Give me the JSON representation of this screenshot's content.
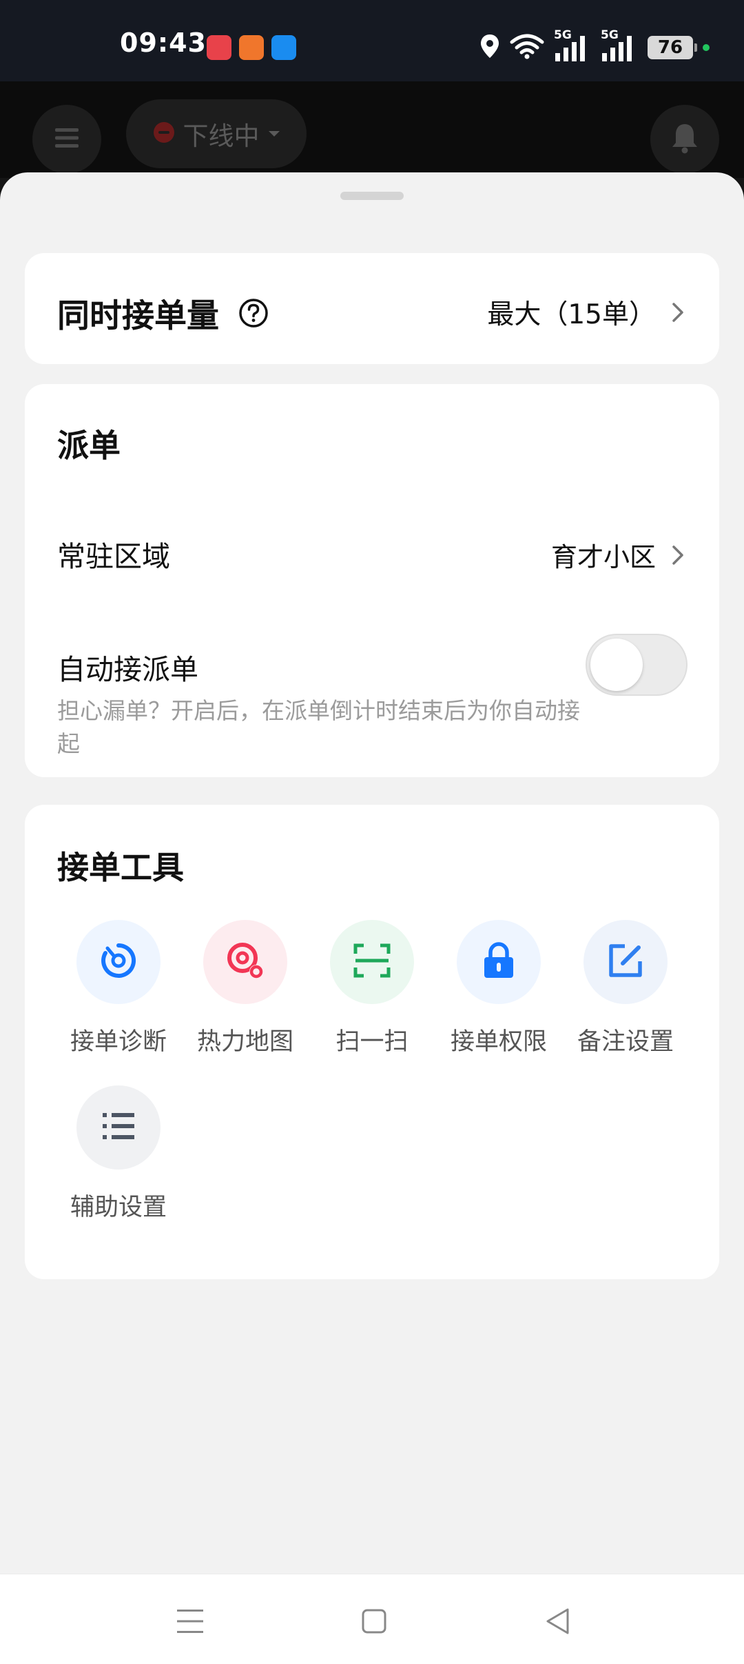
{
  "status_bar": {
    "time": "09:43",
    "battery": "76",
    "network": "5G",
    "icons": [
      "location-icon",
      "wifi-icon",
      "signal-icon",
      "battery-icon"
    ],
    "notification_apps": [
      {
        "name": "app-red-icon",
        "color": "#e8424a"
      },
      {
        "name": "app-orange-icon",
        "color": "#f0762c"
      },
      {
        "name": "app-blue-icon",
        "color": "#1a8cf0"
      }
    ]
  },
  "header": {
    "menu_icon": "menu-icon",
    "status_label": "下线中",
    "status_icon": "minus-circle-icon",
    "bell_icon": "bell-icon"
  },
  "concurrent": {
    "title": "同时接单量",
    "value": "最大（15单）"
  },
  "dispatch": {
    "title": "派单",
    "area_label": "常驻区域",
    "area_value": "育才小区",
    "auto_label": "自动接派单",
    "auto_desc": "担心漏单？开启后，在派单倒计时结束后为你自动接起",
    "auto_enabled": false
  },
  "tools": {
    "title": "接单工具",
    "items": [
      {
        "label": "接单诊断",
        "icon": "diagnosis-icon",
        "bg": "#eef5ff",
        "color": "#1677ff"
      },
      {
        "label": "热力地图",
        "icon": "heatmap-icon",
        "bg": "#fdecef",
        "color": "#f23655"
      },
      {
        "label": "扫一扫",
        "icon": "scan-icon",
        "bg": "#ebf8f0",
        "color": "#1ea85a"
      },
      {
        "label": "接单权限",
        "icon": "lock-icon",
        "bg": "#eef5ff",
        "color": "#1677ff"
      },
      {
        "label": "备注设置",
        "icon": "edit-note-icon",
        "bg": "#eef3fb",
        "color": "#2f7ff0"
      },
      {
        "label": "辅助设置",
        "icon": "list-icon",
        "bg": "#f0f1f3",
        "color": "#4c5563"
      }
    ]
  },
  "nav": {
    "icons": [
      "recents-icon",
      "home-icon",
      "back-icon"
    ]
  },
  "colors": {
    "sheet_bg": "#f2f2f2",
    "card_bg": "#ffffff",
    "muted_text": "#9b9b9b"
  }
}
